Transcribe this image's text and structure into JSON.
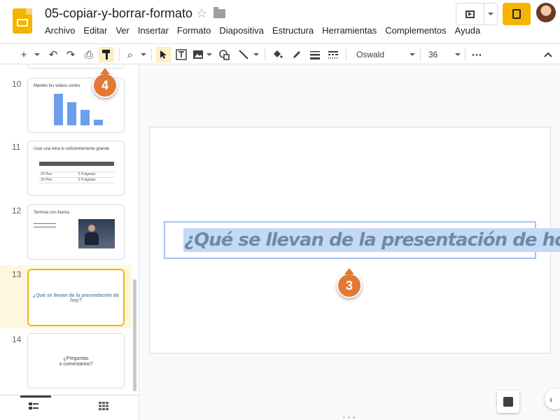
{
  "header": {
    "doc_title": "05-copiar-y-borrar-formato",
    "menu": [
      "Archivo",
      "Editar",
      "Ver",
      "Insertar",
      "Formato",
      "Diapositiva",
      "Estructura",
      "Herramientas",
      "Complementos",
      "Ayuda"
    ]
  },
  "toolbar": {
    "font": "Oswald",
    "size": "36",
    "active_tool": "paint-format"
  },
  "slides": [
    {
      "number": "10",
      "title": "Mantén los videos cortos",
      "chart_values": [
        85,
        62,
        42,
        16
      ]
    },
    {
      "number": "11",
      "title": "Usar una letra lo suficientemente grande",
      "table": [
        [
          "",
          ""
        ],
        [
          "20 Pies",
          "2 Pulgadas"
        ],
        [
          "30 Pies",
          "3 Pulgadas"
        ]
      ]
    },
    {
      "number": "12",
      "title": "Termina con fuerza"
    },
    {
      "number": "13",
      "title": "¿Qué se llevan de la presentación de hoy?",
      "selected": true
    },
    {
      "number": "14",
      "title": "¿Preguntas",
      "title2": "o comentarios?"
    }
  ],
  "canvas": {
    "slide_text": "¿Qué se llevan de la presentación de hoy?"
  },
  "callouts": {
    "c3": "3",
    "c4": "4"
  },
  "colors": {
    "accent": "#f4b400",
    "selection": "#a4c2f4",
    "callout": "#e07a35"
  }
}
